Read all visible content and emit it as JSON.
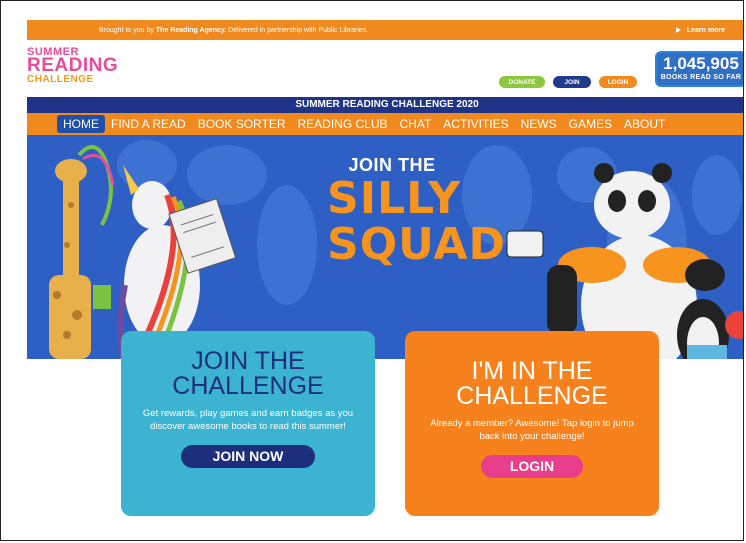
{
  "topbar": {
    "credit_prefix": "Brought to you by ",
    "credit_agency": "The Reading Agency.",
    "credit_suffix": " Delivered in partnership with Public Libraries.",
    "learn_more": "Learn more"
  },
  "logo": {
    "line1": "SUMMER",
    "line2": "READING",
    "line3": "CHALLENGE"
  },
  "header_buttons": {
    "donate": "DONATE",
    "join": "JOIN",
    "login": "LOGIN"
  },
  "counter": {
    "value": "1,045,905",
    "label": "BOOKS READ SO FAR"
  },
  "title_bar": "SUMMER READING CHALLENGE 2020",
  "nav": [
    {
      "label": "HOME"
    },
    {
      "label": "FIND A READ"
    },
    {
      "label": "BOOK SORTER"
    },
    {
      "label": "READING CLUB"
    },
    {
      "label": "CHAT"
    },
    {
      "label": "ACTIVITIES"
    },
    {
      "label": "NEWS"
    },
    {
      "label": "GAMES"
    },
    {
      "label": "ABOUT"
    }
  ],
  "hero": {
    "join_the": "JOIN THE",
    "silly": "SILLY",
    "squad": "SQUAD",
    "newspaper_text": "I'M NOT LIFTING HONEST"
  },
  "card_join": {
    "title_line1": "JOIN THE",
    "title_line2": "CHALLENGE",
    "text": "Get rewards, play games and earn badges as you discover awesome books to read this summer!",
    "button": "JOIN NOW"
  },
  "card_login": {
    "title_line1": "I'M IN THE",
    "title_line2": "CHALLENGE",
    "text": "Already a member? Awesome! Tap login to jump back into your challenge!",
    "button": "LOGIN"
  },
  "colors": {
    "orange": "#f18a1e",
    "navy": "#1f3487",
    "pink": "#e83e8c",
    "green": "#8dc63f",
    "teal": "#3bb3d1",
    "hero_blue": "#2e5fc4"
  }
}
